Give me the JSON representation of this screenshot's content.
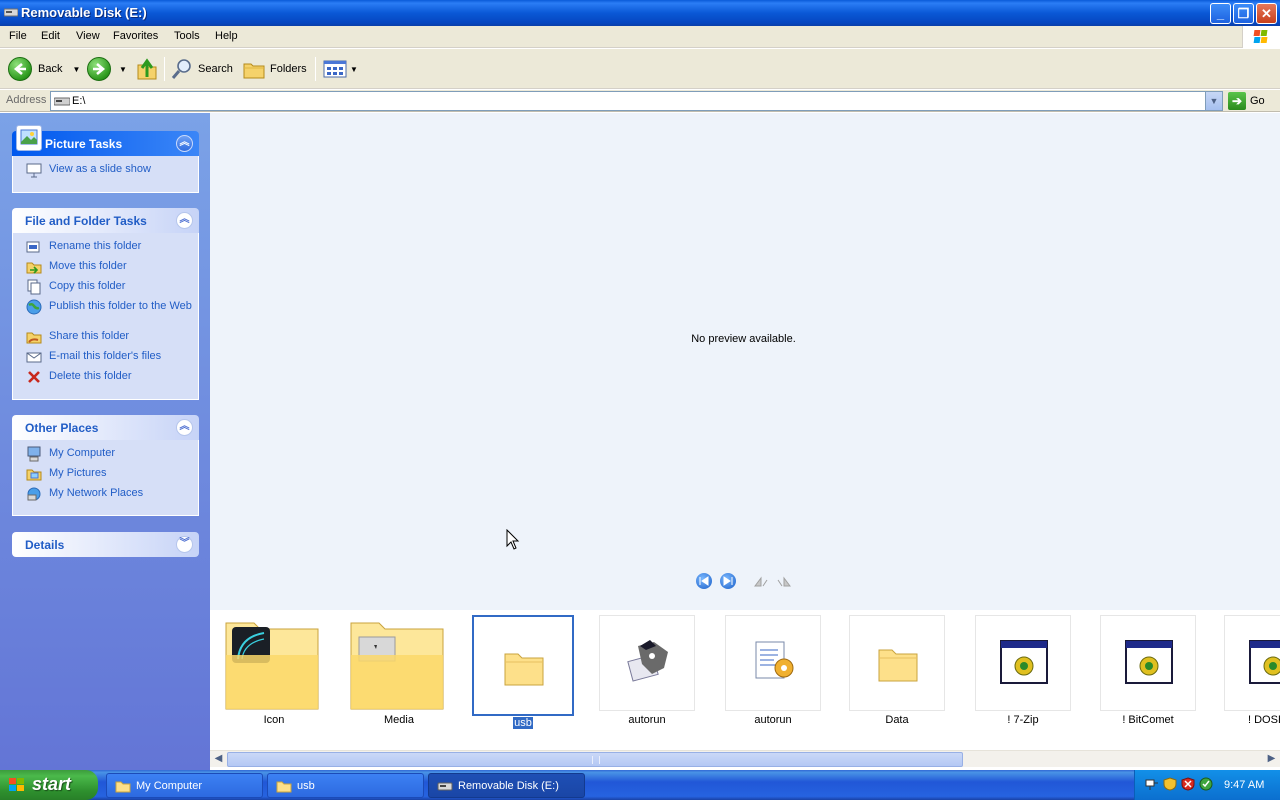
{
  "window": {
    "title": "Removable Disk (E:)",
    "controls": {
      "minimize": "_",
      "maximize": "❐",
      "close": "✕"
    }
  },
  "menu": [
    "File",
    "Edit",
    "View",
    "Favorites",
    "Tools",
    "Help"
  ],
  "toolbar": {
    "back_label": "Back",
    "search_label": "Search",
    "folders_label": "Folders"
  },
  "address": {
    "label": "Address",
    "value": "E:\\",
    "go_label": "Go"
  },
  "left_pane": {
    "picture_tasks": {
      "title": "Picture Tasks",
      "items": [
        "View as a slide show"
      ]
    },
    "file_folder_tasks": {
      "title": "File and Folder Tasks",
      "items": [
        "Rename this folder",
        "Move this folder",
        "Copy this folder",
        "Publish this folder to the Web",
        "Share this folder",
        "E-mail this folder's files",
        "Delete this folder"
      ]
    },
    "other_places": {
      "title": "Other Places",
      "items": [
        "My Computer",
        "My Pictures",
        "My Network Places"
      ]
    },
    "details": {
      "title": "Details"
    }
  },
  "preview": {
    "message": "No preview available."
  },
  "filmstrip": [
    {
      "name": "Icon",
      "icon": "folder-thumbnail-icon",
      "selected": false
    },
    {
      "name": "Media",
      "icon": "folder-thumbnail-icon",
      "selected": false
    },
    {
      "name": "usb",
      "icon": "folder-icon",
      "selected": true
    },
    {
      "name": "autorun",
      "icon": "autorun-app-icon",
      "selected": false
    },
    {
      "name": "autorun",
      "icon": "setup-info-icon",
      "selected": false
    },
    {
      "name": "Data",
      "icon": "folder-icon",
      "selected": false
    },
    {
      "name": "! 7-Zip",
      "icon": "application-icon",
      "selected": false
    },
    {
      "name": "! BitComet",
      "icon": "application-icon",
      "selected": false
    },
    {
      "name": "! DOSB",
      "icon": "application-icon",
      "selected": false
    }
  ],
  "taskbar": {
    "start_label": "start",
    "tasks": [
      {
        "label": "My Computer",
        "active": false
      },
      {
        "label": "usb",
        "active": false
      },
      {
        "label": "Removable Disk (E:)",
        "active": true
      }
    ],
    "clock": "9:47 AM"
  },
  "colors": {
    "titlebar": "#0a58d6",
    "task_link": "#215dc6",
    "selection": "#316ac5",
    "taskbar": "#2157d7",
    "start_button": "#3c9c3c"
  }
}
